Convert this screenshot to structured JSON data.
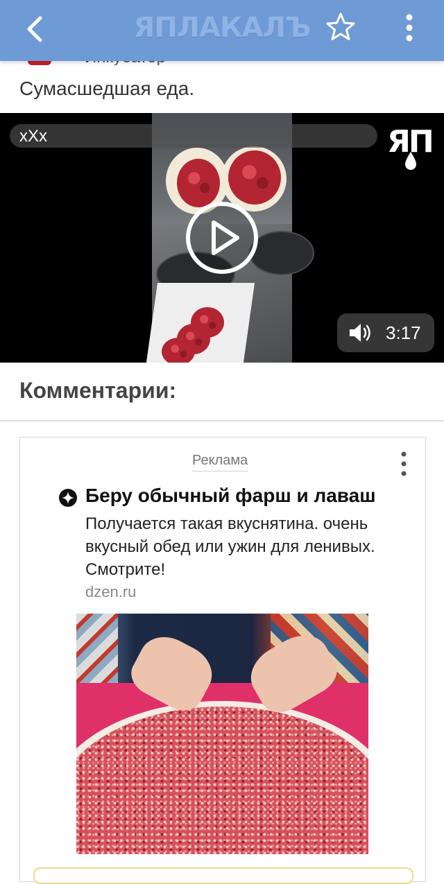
{
  "app": {
    "logo_text": "ЯПЛАКАЛЪ"
  },
  "topbar": {
    "back_icon": "chevron-left-icon",
    "favorite_icon": "star-outline-icon",
    "more_icon": "more-vertical-icon"
  },
  "post": {
    "author_partial": "Инкубатор",
    "title": "Сумасшедшая еда."
  },
  "video": {
    "title": "xXx",
    "watermark": "ЯП",
    "duration": "3:17",
    "play_icon": "play-circle-icon",
    "volume_icon": "volume-icon"
  },
  "comments": {
    "heading": "Комментарии:"
  },
  "ad": {
    "label": "Реклама",
    "title": "Беру обычный фарш и лаваш",
    "description": "Получается такая вкуснятина. очень вкусный обед или ужин для ленивых. Смотрите!",
    "domain": "dzen.ru",
    "source_icon": "dzen-icon",
    "menu_icon": "more-vertical-icon"
  },
  "colors": {
    "topbar": "#6e9ad5",
    "text_dark": "#333333",
    "ad_label": "#777777"
  }
}
